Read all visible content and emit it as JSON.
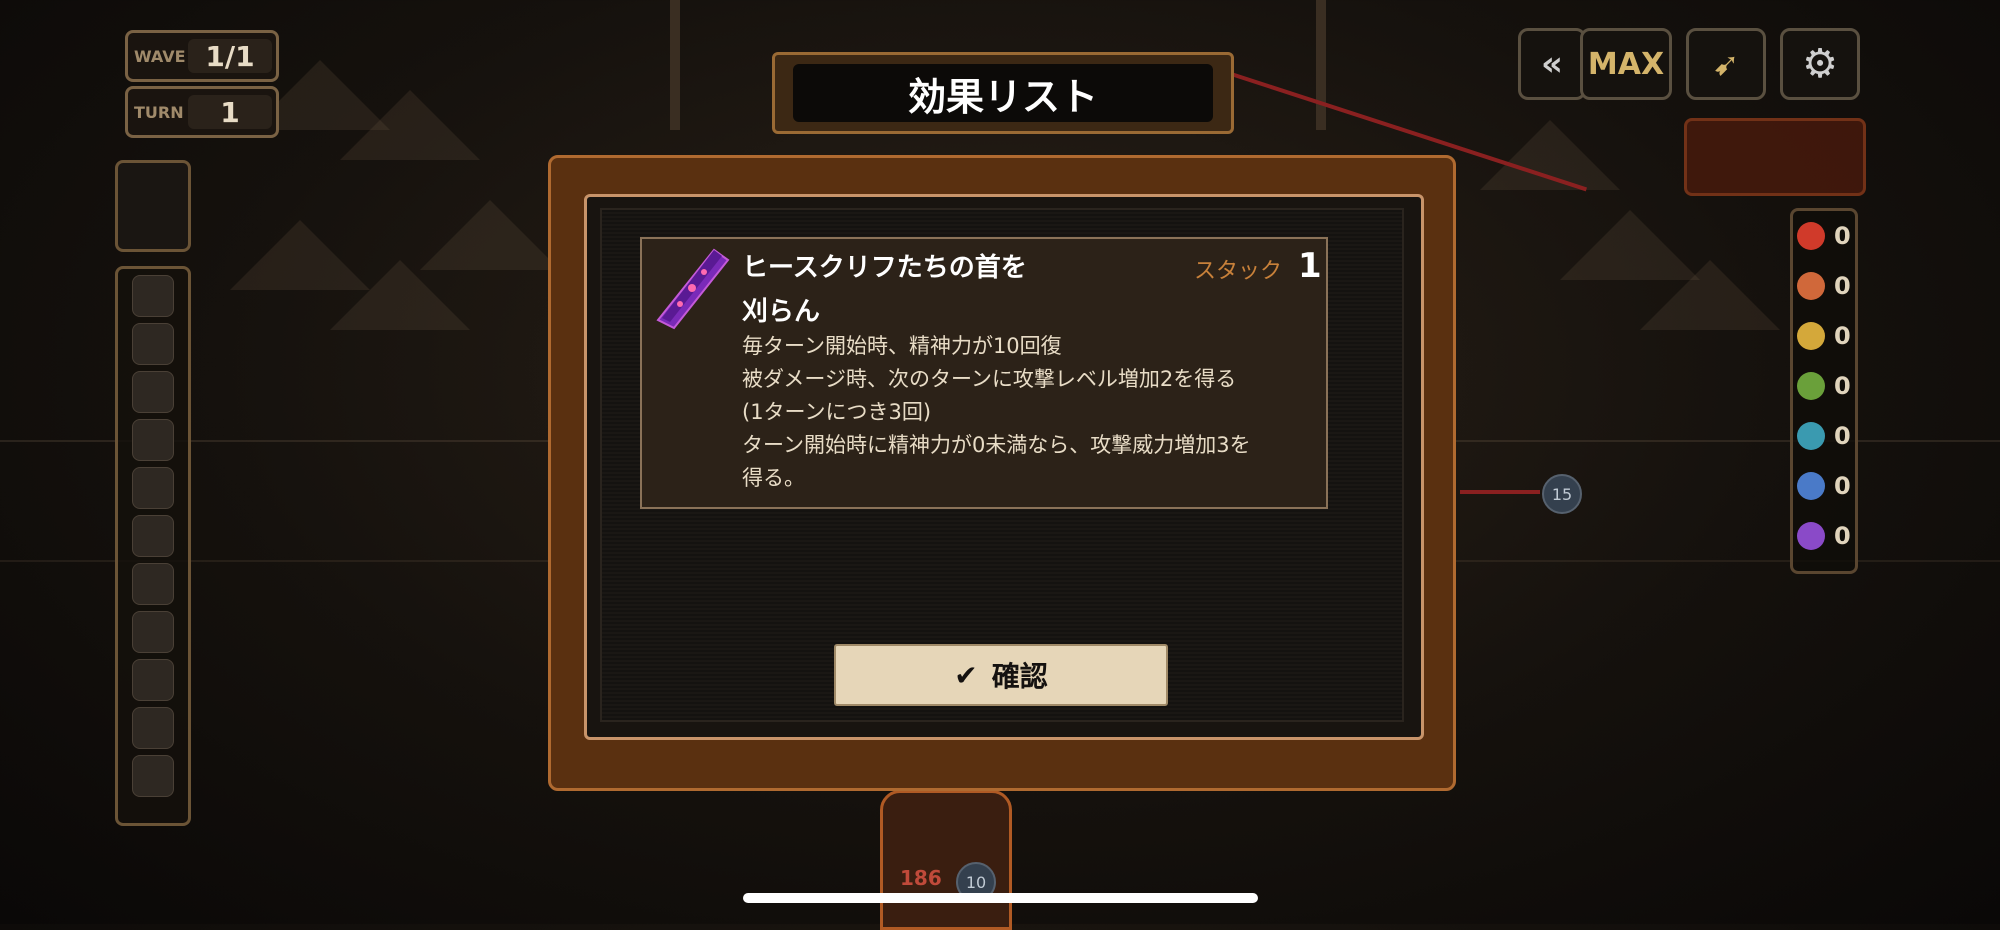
{
  "hud": {
    "wave_label": "WAVE",
    "wave_value": "1/1",
    "turn_label": "TURN",
    "turn_value": "1"
  },
  "top_controls": {
    "back_icon": "double-chevron-left-icon",
    "speed_label": "MAX",
    "skip_icon": "arrow-burst-icon",
    "settings_icon": "gear-icon"
  },
  "resources": [
    {
      "icon": "flame-icon",
      "value": "0",
      "color": "#d03a2a"
    },
    {
      "icon": "chain-icon",
      "value": "0",
      "color": "#d0683a"
    },
    {
      "icon": "cloud-icon",
      "value": "0",
      "color": "#d4a83a"
    },
    {
      "icon": "leaf-icon",
      "value": "0",
      "color": "#6aa03a"
    },
    {
      "icon": "wave-icon",
      "value": "0",
      "color": "#3a9ab0"
    },
    {
      "icon": "crystal-icon",
      "value": "0",
      "color": "#4a7ac8"
    },
    {
      "icon": "flower-icon",
      "value": "0",
      "color": "#8a4ac8"
    }
  ],
  "badges": {
    "right_badge": "15",
    "bottom_badge": "10",
    "bottom_hp": "186"
  },
  "dialog": {
    "title": "効果リスト",
    "effect_title": "ヒースクリフたちの首を刈らん",
    "stack_label": "スタック",
    "stack_value": "1",
    "desc_line1": "毎ターン開始時、精神力が10回復",
    "desc_line2": "被ダメージ時、次のターンに攻撃レベル増加2を得る",
    "desc_line3": "(1ターンにつき3回)",
    "desc_line4": "ターン開始時に精神力が0未満なら、攻撃威力増加3を",
    "desc_line5": "得る。",
    "confirm_label": "確認"
  },
  "colors": {
    "accent_orange": "#c8813a",
    "frame_copper": "#b06a30",
    "effect_icon_purple": "#8a3ad0"
  }
}
